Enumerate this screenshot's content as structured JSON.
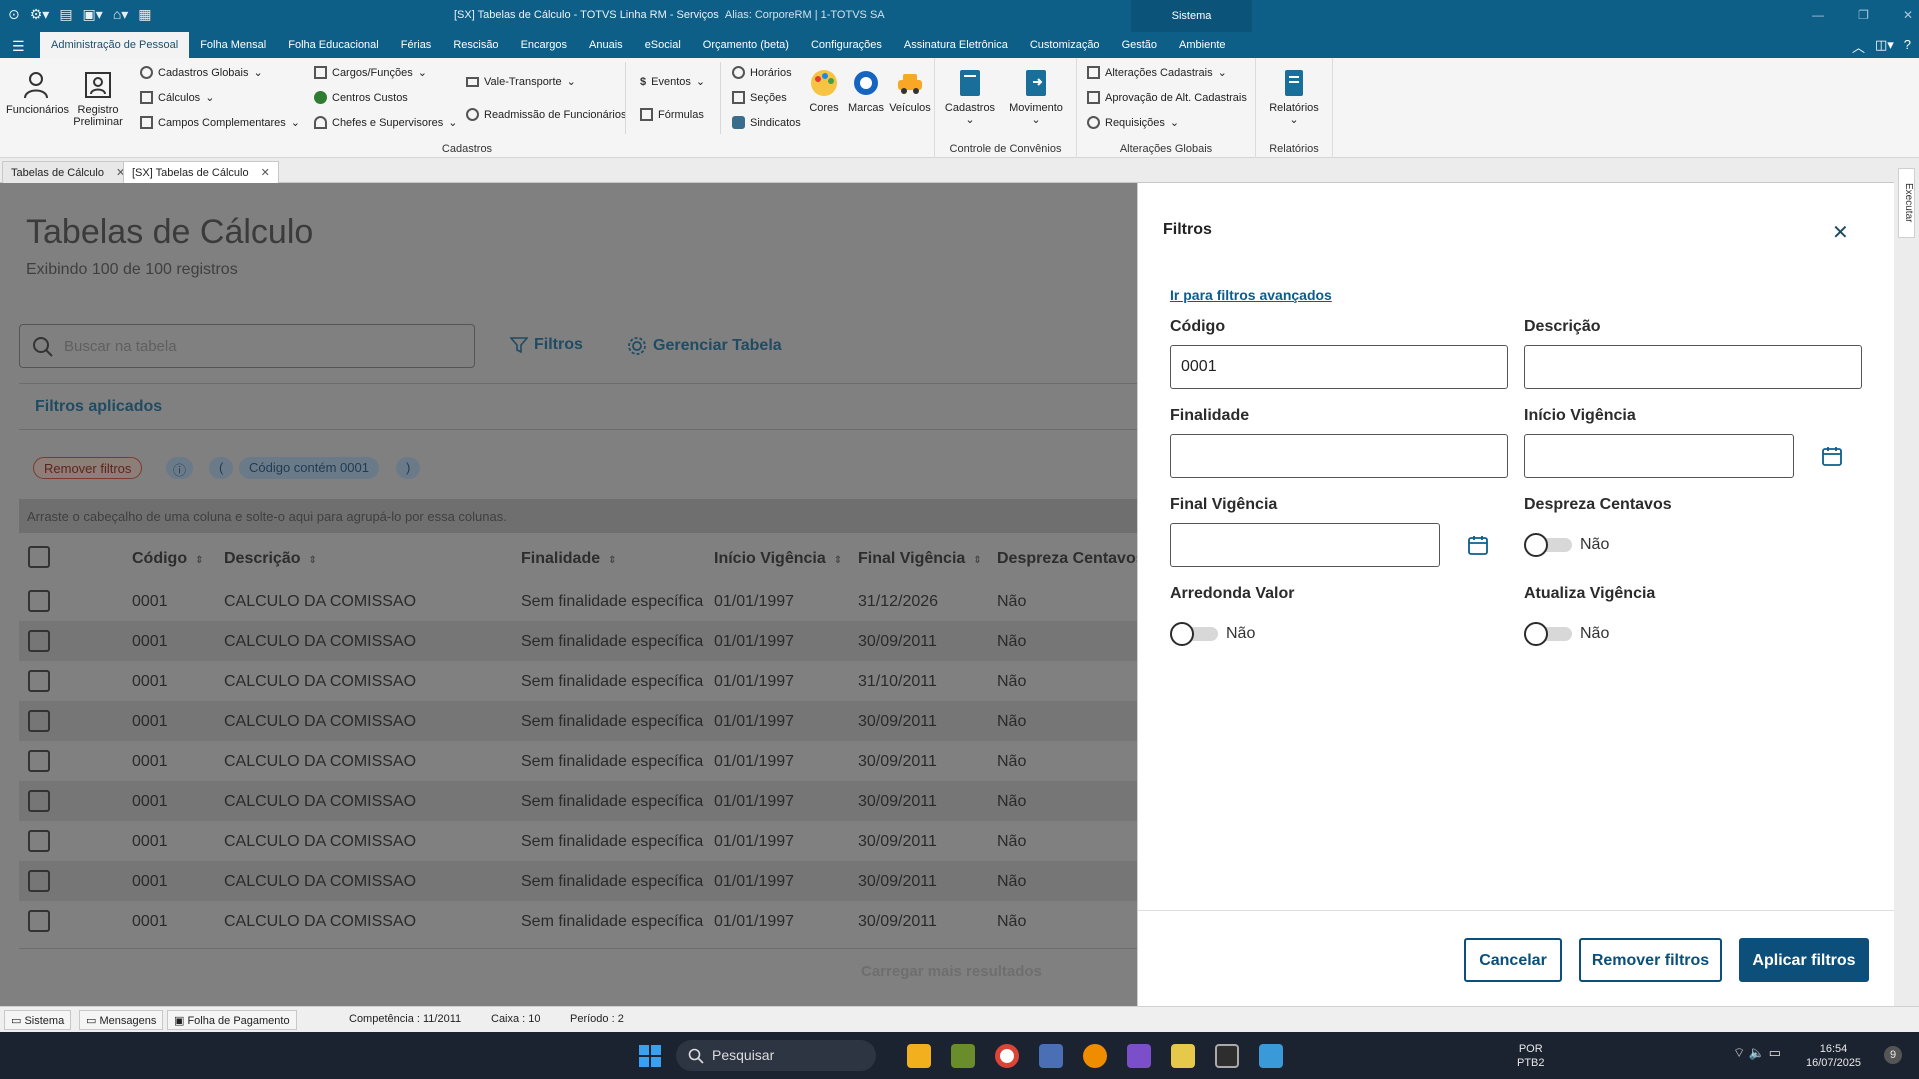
{
  "window": {
    "title": "[SX] Tabelas de Cálculo - TOTVS Linha RM - Serviços",
    "alias": "Alias: CorporeRM | 1-TOTVS SA",
    "sistema_label": "Sistema"
  },
  "menu": {
    "tabs": [
      "Administração de Pessoal",
      "Folha Mensal",
      "Folha Educacional",
      "Férias",
      "Rescisão",
      "Encargos",
      "Anuais",
      "eSocial",
      "Orçamento (beta)",
      "Configurações",
      "Assinatura Eletrônica",
      "Customização",
      "Gestão",
      "Ambiente"
    ]
  },
  "ribbon": {
    "funcionarios": "Funcionários",
    "registro_preliminar": "Registro Preliminar",
    "cadastros_globais": "Cadastros Globais",
    "calculos": "Cálculos",
    "campos_complementares": "Campos Complementares",
    "cargos_funcoes": "Cargos/Funções",
    "centros_custos": "Centros Custos",
    "chefes_supervisores": "Chefes e Supervisores",
    "vale_transporte": "Vale-Transporte",
    "readmissao": "Readmissão de Funcionários",
    "eventos": "Eventos",
    "formulas": "Fórmulas",
    "horarios": "Horários",
    "secoes": "Seções",
    "sindicatos": "Sindicatos",
    "cores": "Cores",
    "marcas": "Marcas",
    "veiculos": "Veículos",
    "group_cadastros": "Cadastros",
    "cadastros_btn": "Cadastros",
    "movimento_btn": "Movimento",
    "group_convenios": "Controle de Convênios",
    "alteracoes_cadastrais": "Alterações Cadastrais",
    "aprovacao_alt": "Aprovação de Alt. Cadastrais",
    "requisicoes": "Requisições",
    "group_alteracoes": "Alterações Globais",
    "relatorios_btn": "Relatórios",
    "group_relatorios": "Relatórios"
  },
  "doctabs": [
    "Tabelas de Cálculo",
    "[SX] Tabelas de Cálculo"
  ],
  "page": {
    "title": "Tabelas de Cálculo",
    "subtitle": "Exibindo 100 de 100 registros",
    "search_placeholder": "Buscar na tabela",
    "filtros_btn": "Filtros",
    "gerenciar_btn": "Gerenciar Tabela",
    "filtros_aplicados": "Filtros aplicados",
    "remover_filtros_chip": "Remover filtros",
    "paren_open": "(",
    "chip_codigo": "Código contém 0001",
    "paren_close": ")",
    "group_hint": "Arraste o cabeçalho de uma coluna e solte-o aqui para agrupá-lo por essa colunas.",
    "load_more": "Carregar mais resultados"
  },
  "table": {
    "columns": [
      "Código",
      "Descrição",
      "Finalidade",
      "Início Vigência",
      "Final Vigência",
      "Despreza Centavos"
    ],
    "rows": [
      [
        "0001",
        "CALCULO DA COMISSAO",
        "Sem finalidade específica",
        "01/01/1997",
        "31/12/2026",
        "Não"
      ],
      [
        "0001",
        "CALCULO DA COMISSAO",
        "Sem finalidade específica",
        "01/01/1997",
        "30/09/2011",
        "Não"
      ],
      [
        "0001",
        "CALCULO DA COMISSAO",
        "Sem finalidade específica",
        "01/01/1997",
        "31/10/2011",
        "Não"
      ],
      [
        "0001",
        "CALCULO DA COMISSAO",
        "Sem finalidade específica",
        "01/01/1997",
        "30/09/2011",
        "Não"
      ],
      [
        "0001",
        "CALCULO DA COMISSAO",
        "Sem finalidade específica",
        "01/01/1997",
        "30/09/2011",
        "Não"
      ],
      [
        "0001",
        "CALCULO DA COMISSAO",
        "Sem finalidade específica",
        "01/01/1997",
        "30/09/2011",
        "Não"
      ],
      [
        "0001",
        "CALCULO DA COMISSAO",
        "Sem finalidade específica",
        "01/01/1997",
        "30/09/2011",
        "Não"
      ],
      [
        "0001",
        "CALCULO DA COMISSAO",
        "Sem finalidade específica",
        "01/01/1997",
        "30/09/2011",
        "Não"
      ],
      [
        "0001",
        "CALCULO DA COMISSAO",
        "Sem finalidade específica",
        "01/01/1997",
        "30/09/2011",
        "Não"
      ]
    ]
  },
  "filters_panel": {
    "title": "Filtros",
    "advanced_link": "Ir para filtros avançados",
    "codigo_label": "Código",
    "codigo_value": "0001",
    "descricao_label": "Descrição",
    "descricao_value": "",
    "finalidade_label": "Finalidade",
    "finalidade_value": "",
    "inicio_label": "Início Vigência",
    "inicio_value": "",
    "final_label": "Final Vigência",
    "final_value": "",
    "despreza_label": "Despreza Centavos",
    "despreza_value": "Não",
    "arredonda_label": "Arredonda Valor",
    "arredonda_value": "Não",
    "atualiza_label": "Atualiza Vigência",
    "atualiza_value": "Não",
    "cancel_btn": "Cancelar",
    "remove_btn": "Remover filtros",
    "apply_btn": "Aplicar filtros"
  },
  "sidebar": {
    "executar": "Executar"
  },
  "statusbar": {
    "sistema": "Sistema",
    "mensagens": "Mensagens",
    "folha": "Folha de Pagamento",
    "competencia": "Competência : 11/2011",
    "caixa": "Caixa : 10",
    "periodo": "Período : 2"
  },
  "taskbar": {
    "search": "Pesquisar",
    "lang1": "POR",
    "lang2": "PTB2",
    "time": "16:54",
    "date": "16/07/2025",
    "badge": "9"
  },
  "colors": {
    "brand": "#0e5f87",
    "primary_button": "#0b4f7a",
    "link": "#0b5e8c"
  }
}
